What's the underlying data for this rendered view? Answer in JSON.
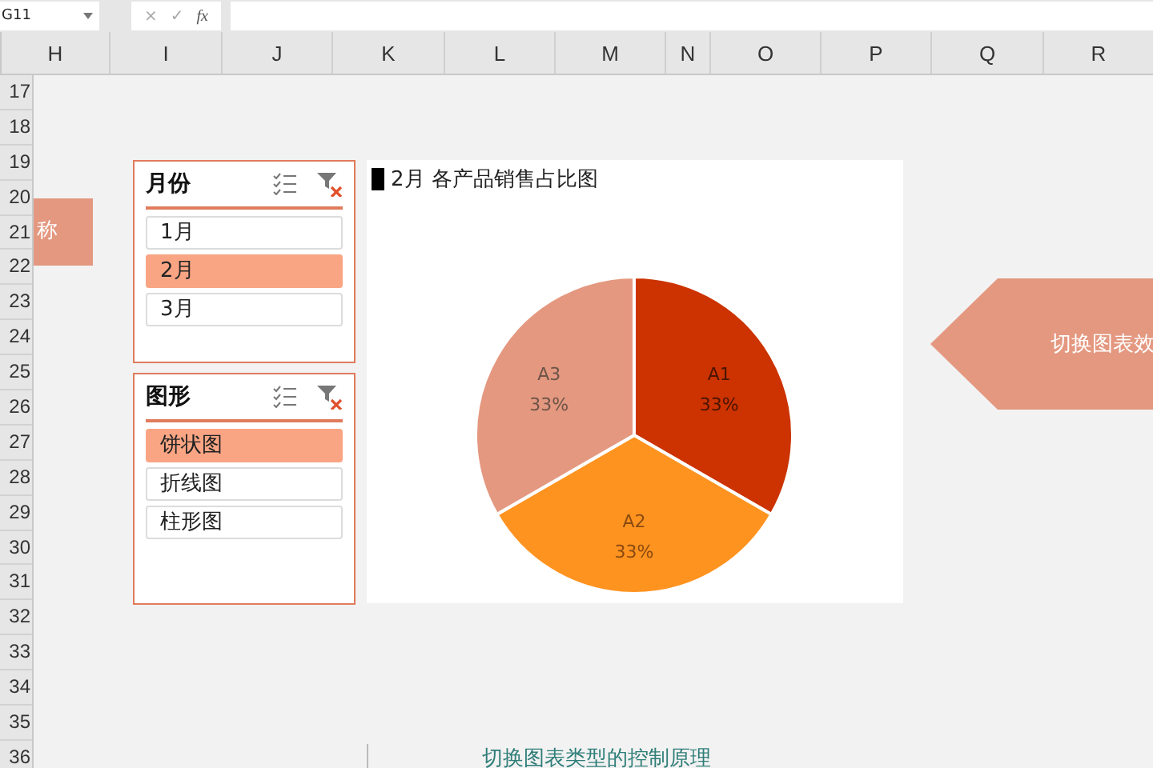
{
  "formula_bar": {
    "name_box": "G11",
    "cancel": "×",
    "enter": "✓",
    "function": "fx"
  },
  "column_headers": [
    "H",
    "I",
    "J",
    "K",
    "L",
    "M",
    "N",
    "O",
    "P",
    "Q",
    "R"
  ],
  "row_headers": [
    "17",
    "18",
    "19",
    "20",
    "21",
    "22",
    "23",
    "24",
    "25",
    "26",
    "27",
    "28",
    "29",
    "30",
    "31",
    "32",
    "33",
    "34",
    "35",
    "36"
  ],
  "shapes": [
    {
      "kind": "rect",
      "text": "称"
    },
    {
      "kind": "arrow",
      "text": "切换图表效"
    }
  ],
  "slicers": [
    {
      "title": "月份",
      "items": [
        {
          "label": "1月",
          "selected": false
        },
        {
          "label": "2月",
          "selected": true
        },
        {
          "label": "3月",
          "selected": false
        }
      ]
    },
    {
      "title": "图形",
      "items": [
        {
          "label": "饼状图",
          "selected": true
        },
        {
          "label": "折线图",
          "selected": false
        },
        {
          "label": "柱形图",
          "selected": false
        }
      ]
    }
  ],
  "chart": {
    "title": "2月 各产品销售占比图",
    "chart_data": {
      "type": "pie",
      "categories": [
        "A1",
        "A2",
        "A3"
      ],
      "values": [
        33,
        33,
        33
      ],
      "data_labels": true,
      "value_labels": [
        "33%",
        "33%",
        "33%"
      ]
    }
  },
  "caption": "切换图表类型的控制原理"
}
